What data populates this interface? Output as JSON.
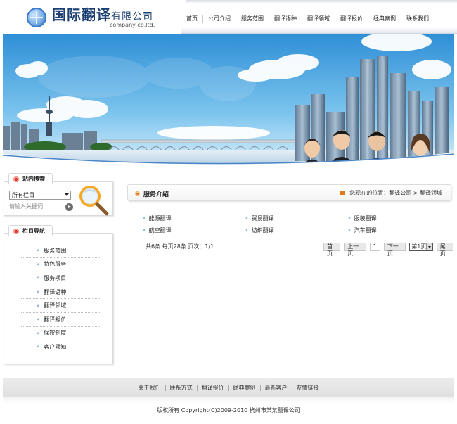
{
  "header": {
    "logo_cn": "国际翻译",
    "logo_cn_suffix": "有限公司",
    "logo_en": "company co,ltd.",
    "nav": [
      "首页",
      "公司介绍",
      "服务范围",
      "翻译语种",
      "翻译领域",
      "翻译报价",
      "经典案例",
      "联系我们"
    ]
  },
  "search": {
    "title": "站内搜索",
    "select_value": "所有栏目",
    "keyword_placeholder": "请输入关键词"
  },
  "sidebar": {
    "title": "栏目导航",
    "items": [
      "服务范围",
      "特色服务",
      "服务项目",
      "翻译语种",
      "翻译领域",
      "翻译报价",
      "保密制度",
      "客户须知"
    ]
  },
  "main": {
    "title": "服务介绍",
    "breadcrumb": "您现在的位置：翻译公司 > 翻译领域",
    "items": [
      "能源翻译",
      "贸易翻译",
      "服装翻译",
      "航空翻译",
      "纺织翻译",
      "汽车翻译"
    ]
  },
  "pagination": {
    "info": "共6条  每页28条  页次：1/1",
    "first": "首页",
    "prev": "上一页",
    "current": "1",
    "next": "下一页",
    "select_value": "第1页",
    "last": "尾页"
  },
  "footer": {
    "links": [
      "关于我们",
      "联系方式",
      "翻译报价",
      "经典案例",
      "最新客户",
      "友情链接"
    ],
    "copyright": "版权所有  Copyright(C)2009-2010 杭州市某某翻译公司"
  },
  "colors": {
    "brand_blue": "#1c3f73",
    "accent_orange": "#e07a1f",
    "accent_red": "#d9352b",
    "sky": "#3ea0e0"
  }
}
